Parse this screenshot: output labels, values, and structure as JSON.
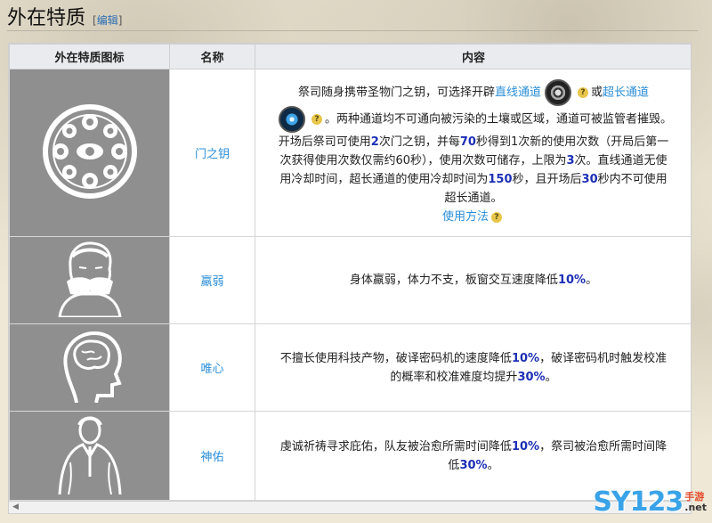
{
  "header": {
    "title": "外在特质",
    "edit_open": "[",
    "edit_label": "编辑",
    "edit_close": "]"
  },
  "table": {
    "columns": [
      "外在特质图标",
      "名称",
      "内容"
    ],
    "rows": [
      {
        "icon": "gate-key-emblem-icon",
        "name": "门之钥",
        "content": {
          "p1": "祭司随身携带圣物门之钥，可选择开辟",
          "link1": "直线通道",
          "or": "或",
          "link2": "超长通道",
          "p2": "。两种通道均不可通向被污染的土壤或区域，通道可被监管者摧毁。开场后祭司可使用",
          "v1": "2",
          "p3": "次门之钥，并每",
          "v2": "70",
          "p4": "秒得到1次新的使用次数（开局后第一次获得使用次数仅需约60秒），使用次数可储存，上限为",
          "v3": "3",
          "p5": "次。直线通道无使用冷却时间，超长通道的使用冷却时间为",
          "v4": "150",
          "p6": "秒，且开场后",
          "v5": "30",
          "p7": "秒内不可使用超长通道。",
          "usage_link": "使用方法"
        }
      },
      {
        "icon": "covering-mouth-face-icon",
        "name": "羸弱",
        "content": {
          "p1": "身体羸弱，体力不支，板窗交互速度降低",
          "v1": "10%",
          "p2": "。"
        }
      },
      {
        "icon": "head-brain-icon",
        "name": "唯心",
        "content": {
          "p1": "不擅长使用科技产物，破译密码机的速度降低",
          "v1": "10%",
          "p2": "，破译密码机时触发校准的概率和校准难度均提升",
          "v2": "30%",
          "p3": "。"
        }
      },
      {
        "icon": "praying-figure-icon",
        "name": "神佑",
        "content": {
          "p1": "虔诚祈祷寻求庇佑，队友被治愈所需时间降低",
          "v1": "10%",
          "p2": "，祭司被治愈所需时间降低",
          "v2": "30%",
          "p3": "。"
        }
      }
    ]
  },
  "help_glyph": "?",
  "scroll_left_glyph": "◀",
  "watermark": {
    "logo": "SY123",
    "sub1": "手游",
    "sub2": ".net"
  },
  "colors": {
    "highlight": "#1d2fb5",
    "link": "#2a8ed8",
    "icon_bg": "#8f8f8f",
    "header_bg": "#e9ebef"
  }
}
